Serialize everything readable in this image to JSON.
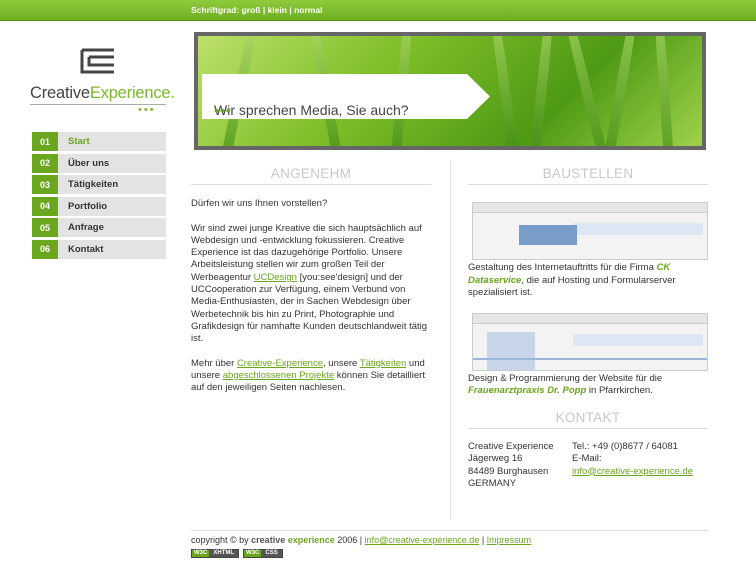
{
  "topbar": {
    "label": "Schriftgrad:",
    "gross": "groß",
    "sep1": "|",
    "klein": "klein",
    "sep2": "|",
    "normal": "normal"
  },
  "logo": {
    "text_a": "Creative",
    "text_b": "Experience.",
    "dots": "•••"
  },
  "nav": [
    {
      "num": "01",
      "label": "Start"
    },
    {
      "num": "02",
      "label": "Über uns"
    },
    {
      "num": "03",
      "label": "Tätigkeiten"
    },
    {
      "num": "04",
      "label": "Portfolio"
    },
    {
      "num": "05",
      "label": "Anfrage"
    },
    {
      "num": "06",
      "label": "Kontakt"
    }
  ],
  "hero": {
    "slogan": "Wir sprechen Media, Sie auch?",
    "dots": "•••"
  },
  "left": {
    "title": "ANGENEHM",
    "p1": "Dürfen wir uns Ihnen vorstellen?",
    "p2a": "Wir sind zwei junge Kreative die sich hauptsächlich auf Webdesign und -entwicklung fokussieren. Creative Experience ist das dazugehörige Portfolio. Unsere Arbeitsleistung stellen wir zum großen Teil der Werbeagentur ",
    "link_ucdesign": "UCDesign",
    "p2b": " [you:see'design] und der UCCooperation zur Verfügung, einem Verbund von Media-Enthusiasten, der in Sachen Webdesign über Werbetechnik bis hin zu Print, Photographie und Grafikdesign für namhafte Kunden deutschlandweit tätig ist.",
    "p3a": "Mehr über ",
    "link_ce": "Creative-Experience",
    "p3b": ", unsere ",
    "link_t": "Tätigkeiten",
    "p3c": " und unsere ",
    "link_p": "abgeschlossenen Projekte",
    "p3d": " können Sie detailliert auf den jeweiligen Seiten nachlesen."
  },
  "right": {
    "title": "BAUSTELLEN",
    "c1a": "Gestaltung des Internetauftritts für die Firma ",
    "c1b": "CK Dataservice",
    "c1c": ", die auf Hosting und Formularserver spezialisiert ist.",
    "c2a": "Design & Programmierung der Website für die ",
    "c2b": "Frauenarztpraxis Dr. Popp",
    "c2c": " in Pfarrkirchen.",
    "contact_title": "KONTAKT",
    "addr": [
      "Creative Experience",
      "Jägerweg 16",
      "84489 Burghausen",
      "GERMANY"
    ],
    "tel": "Tel.: +49 (0)8677 / 64081",
    "email_label": "E-Mail:",
    "email": "info@creative-experience.de"
  },
  "footer": {
    "copy": "copyright © by ",
    "brand_a": "creative",
    "brand_b": "experience",
    "year": " 2006 | ",
    "email": "info@creative-experience.de",
    "sep": " | ",
    "impressum": "Impressum",
    "badge1_l": "W3C",
    "badge1_r": "XHTML",
    "badge2_l": "W3C",
    "badge2_r": "CSS"
  }
}
